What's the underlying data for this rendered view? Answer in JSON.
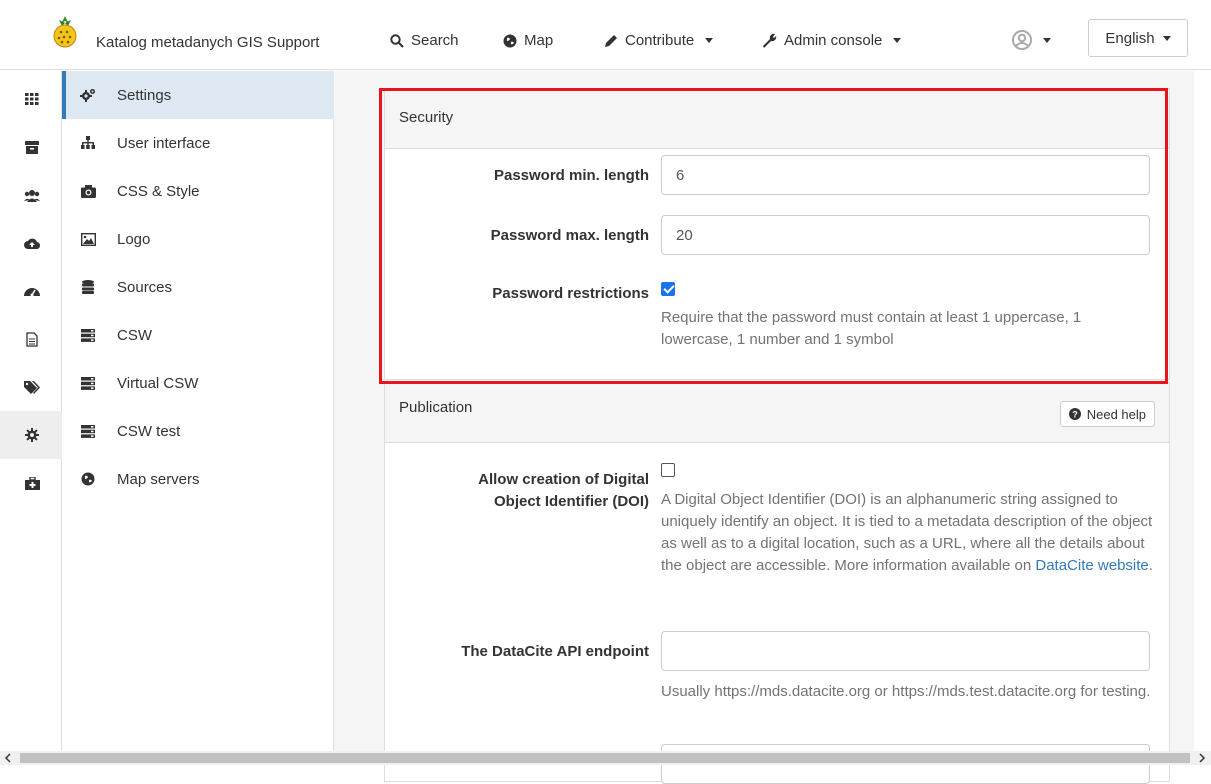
{
  "navbar": {
    "brand": "Katalog metadanych GIS Support",
    "search_label": "Search",
    "map_label": "Map",
    "contribute_label": "Contribute",
    "admin_label": "Admin console",
    "language_label": "English"
  },
  "menu": {
    "items": [
      {
        "label": "Settings",
        "icon": "cogs-icon"
      },
      {
        "label": "User interface",
        "icon": "sitemap-icon"
      },
      {
        "label": "CSS & Style",
        "icon": "camera-icon"
      },
      {
        "label": "Logo",
        "icon": "image-icon"
      },
      {
        "label": "Sources",
        "icon": "database-icon"
      },
      {
        "label": "CSW",
        "icon": "server-icon"
      },
      {
        "label": "Virtual CSW",
        "icon": "server-icon"
      },
      {
        "label": "CSW test",
        "icon": "server-icon"
      },
      {
        "label": "Map servers",
        "icon": "globe-icon"
      }
    ]
  },
  "security": {
    "title": "Security",
    "pw_min_label": "Password min. length",
    "pw_min_value": "6",
    "pw_max_label": "Password max. length",
    "pw_max_value": "20",
    "pw_restrictions_label": "Password restrictions",
    "pw_restrictions_checked": true,
    "pw_restrictions_help": "Require that the password must contain at least 1 uppercase, 1 lowercase, 1 number and 1 symbol"
  },
  "publication": {
    "title": "Publication",
    "need_help_label": "Need help",
    "doi_label_line1": "Allow creation of Digital",
    "doi_label_line2": "Object Identifier (DOI)",
    "doi_checked": false,
    "doi_help": "A Digital Object Identifier (DOI) is an alphanumeric string assigned to uniquely identify an object. It is tied to a metadata description of the object as well as to a digital location, such as a URL, where all the details about the object are accessible. More information available on ",
    "doi_help_link": "DataCite website",
    "doi_help_end": ".",
    "api_label": "The DataCite API endpoint",
    "api_value": "",
    "api_help": "Usually https://mds.datacite.org or https://mds.test.datacite.org for testing."
  },
  "colors": {
    "accent": "#337ab7",
    "highlight": "#e8141e",
    "checkbox": "#1a73e8"
  }
}
